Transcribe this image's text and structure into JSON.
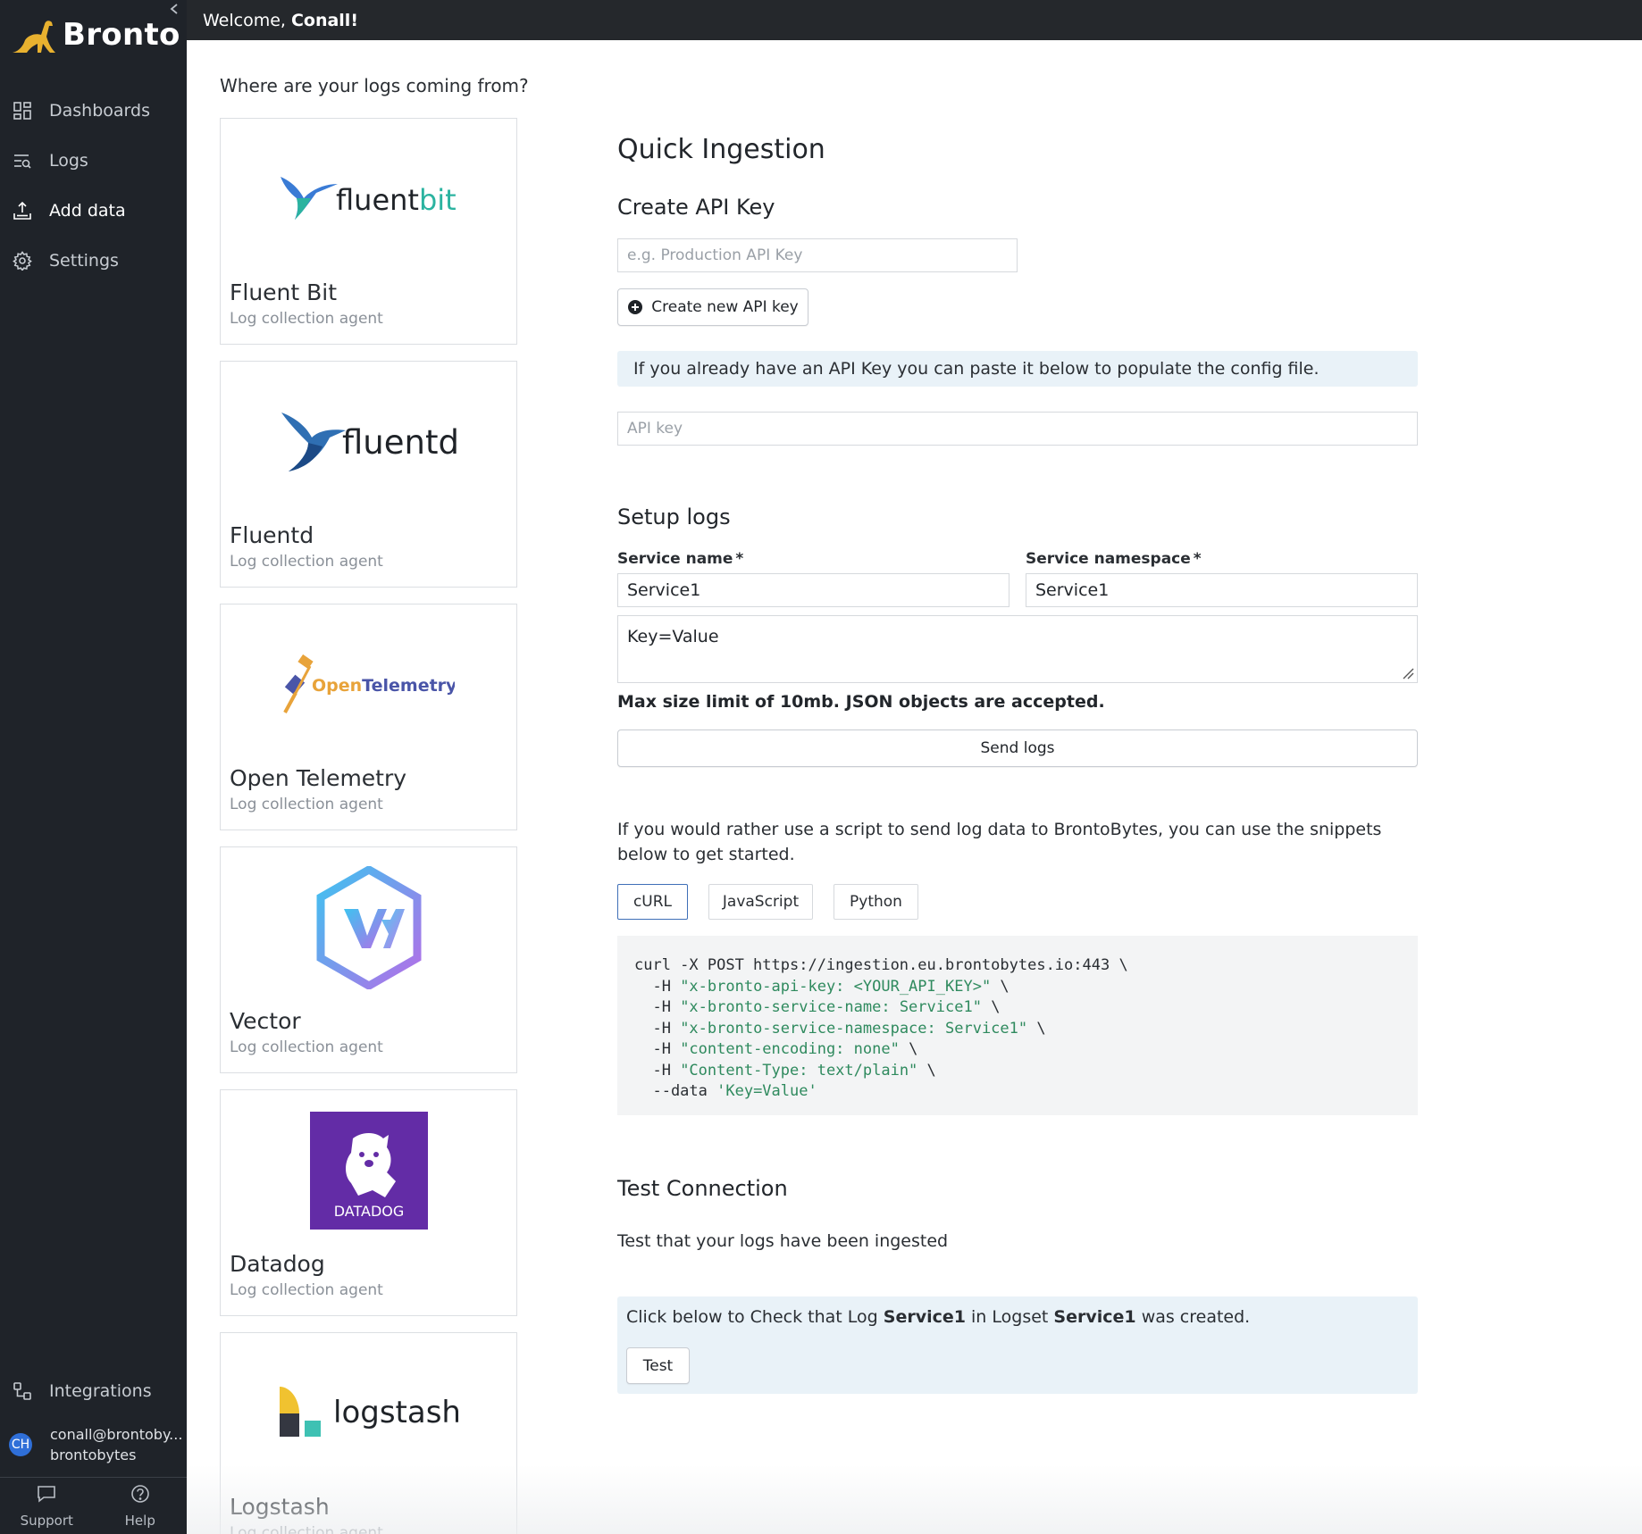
{
  "sidebar": {
    "brand": "Bronto",
    "collapse_icon": "chevron-left-icon",
    "nav": [
      {
        "label": "Dashboards",
        "icon": "dashboard-grid-icon"
      },
      {
        "label": "Logs",
        "icon": "logs-search-icon"
      },
      {
        "label": "Add data",
        "icon": "upload-tray-icon",
        "active": true
      },
      {
        "label": "Settings",
        "icon": "gear-icon"
      }
    ],
    "integrations_label": "Integrations",
    "user": {
      "initials": "CH",
      "email": "conall@brontoby...",
      "org": "brontobytes"
    },
    "footer": {
      "support_label": "Support",
      "help_label": "Help"
    }
  },
  "topbar": {
    "welcome": "Welcome,",
    "user_name": "Conall!"
  },
  "sources": {
    "title": "Where are your logs coming from?",
    "items": [
      {
        "name": "Fluent Bit",
        "desc": "Log collection agent",
        "logo_text": "fluentbit"
      },
      {
        "name": "Fluentd",
        "desc": "Log collection agent",
        "logo_text": "fluentd"
      },
      {
        "name": "Open Telemetry",
        "desc": "Log collection agent",
        "logo_text_a": "Open",
        "logo_text_b": "Telemetry"
      },
      {
        "name": "Vector",
        "desc": "Log collection agent"
      },
      {
        "name": "Datadog",
        "desc": "Log collection agent",
        "logo_text": "DATADOG"
      },
      {
        "name": "Logstash",
        "desc": "Log collection agent",
        "logo_text": "logstash"
      }
    ]
  },
  "quick": {
    "title": "Quick Ingestion",
    "create_key_title": "Create API Key",
    "key_name_placeholder": "e.g. Production API Key",
    "create_key_button": "Create new API key",
    "paste_info": "If you already have an API Key you can paste it below to populate the config file.",
    "api_key_placeholder": "API key",
    "setup_title": "Setup logs",
    "service_name_label": "Service name",
    "service_namespace_label": "Service namespace",
    "required_mark": "*",
    "service_name_value": "Service1",
    "service_namespace_value": "Service1",
    "log_body_value": "Key=Value",
    "size_note": "Max size limit of 10mb. JSON objects are accepted.",
    "send_button": "Send logs",
    "script_para": "If you would rather use a script to send log data to BrontoBytes, you can use the snippets below to get started.",
    "tabs": [
      "cURL",
      "JavaScript",
      "Python"
    ],
    "active_tab": "cURL",
    "code": [
      {
        "pre": "curl -X POST https://ingestion.eu.brontobytes.io:443 \\",
        "str": "",
        "post": ""
      },
      {
        "pre": "  -H ",
        "str": "\"x-bronto-api-key: <YOUR_API_KEY>\"",
        "post": " \\"
      },
      {
        "pre": "  -H ",
        "str": "\"x-bronto-service-name: Service1\"",
        "post": " \\"
      },
      {
        "pre": "  -H ",
        "str": "\"x-bronto-service-namespace: Service1\"",
        "post": " \\"
      },
      {
        "pre": "  -H ",
        "str": "\"content-encoding: none\"",
        "post": " \\"
      },
      {
        "pre": "  -H ",
        "str": "\"Content-Type: text/plain\"",
        "post": " \\"
      },
      {
        "pre": "  --data ",
        "str": "'Key=Value'",
        "post": ""
      }
    ],
    "test_title": "Test Connection",
    "test_para": "Test that your logs have been ingested",
    "check_pre": "Click below to Check that Log",
    "check_log": "Service1",
    "check_mid": "in Logset",
    "check_logset": "Service1",
    "check_post": "was created.",
    "test_button": "Test"
  },
  "colors": {
    "sidebar_bg": "#1f2329",
    "topbar_bg": "#25282c",
    "info_bg": "#e9f2f8",
    "code_string": "#2f8a5e",
    "active_tab_border": "#3f6fb7"
  }
}
